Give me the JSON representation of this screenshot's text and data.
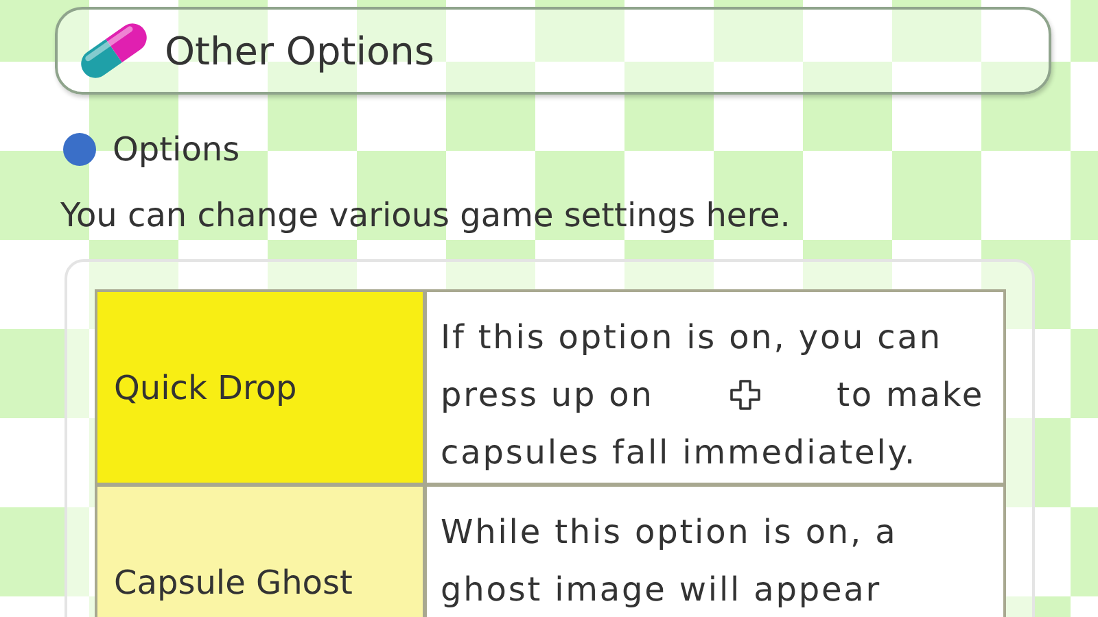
{
  "header": {
    "title": "Other Options"
  },
  "section": {
    "heading": "Options",
    "intro": "You can change various game settings here."
  },
  "rows": [
    {
      "name": "Quick Drop",
      "selected": true,
      "lines": [
        [
          {
            "kind": "text",
            "text": "If this option is on, you can"
          }
        ],
        [
          {
            "kind": "text",
            "text": "press up on"
          },
          {
            "kind": "dpad-icon"
          },
          {
            "kind": "text",
            "text": "to make"
          }
        ],
        [
          {
            "kind": "text",
            "text": "capsules fall immediately."
          }
        ]
      ]
    },
    {
      "name": "Capsule Ghost",
      "selected": false,
      "lines": [
        [
          {
            "kind": "text",
            "text": "While this option is on, a"
          }
        ],
        [
          {
            "kind": "text",
            "text": "ghost image will appear"
          }
        ]
      ]
    }
  ]
}
